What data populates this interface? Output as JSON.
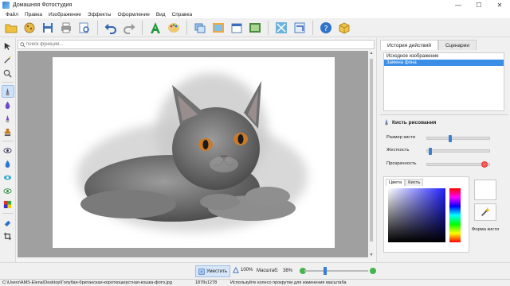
{
  "window": {
    "title": "Домашняя Фотостудия"
  },
  "menu": [
    "Файл",
    "Правка",
    "Изображение",
    "Эффекты",
    "Оформление",
    "Вид",
    "Справка"
  ],
  "search": {
    "placeholder": "поиск функций..."
  },
  "panel": {
    "tabs": [
      "История действий",
      "Сценарии"
    ],
    "history": [
      "Исходное изображение",
      "Замена фона"
    ],
    "brush_title": "Кисть рисования",
    "props": {
      "size": "Размер кисти",
      "hardness": "Жесткость",
      "opacity": "Прозрачность"
    },
    "size_level": 0.36,
    "hardness_level": 0.03,
    "opacity_level": 0.97,
    "color_tabs": [
      "Цвета",
      "Кисть"
    ],
    "brush_shape_label": "Форма кисти"
  },
  "bottom": {
    "fit": "Уместить",
    "zoom100": "100%",
    "scale_label": "Масштаб:",
    "scale_value": "38%"
  },
  "status": {
    "path": "C:\\Users\\AMS-Elena\\Desktop\\Голубая-британская-короткошерстная-кошка-фото.jpg",
    "size": "1878x1278",
    "hint": "Используйте колесо прокрутки для изменения масштаба"
  },
  "colors": {
    "accent": "#3a8ee6",
    "selection": "#3a8ee6"
  }
}
